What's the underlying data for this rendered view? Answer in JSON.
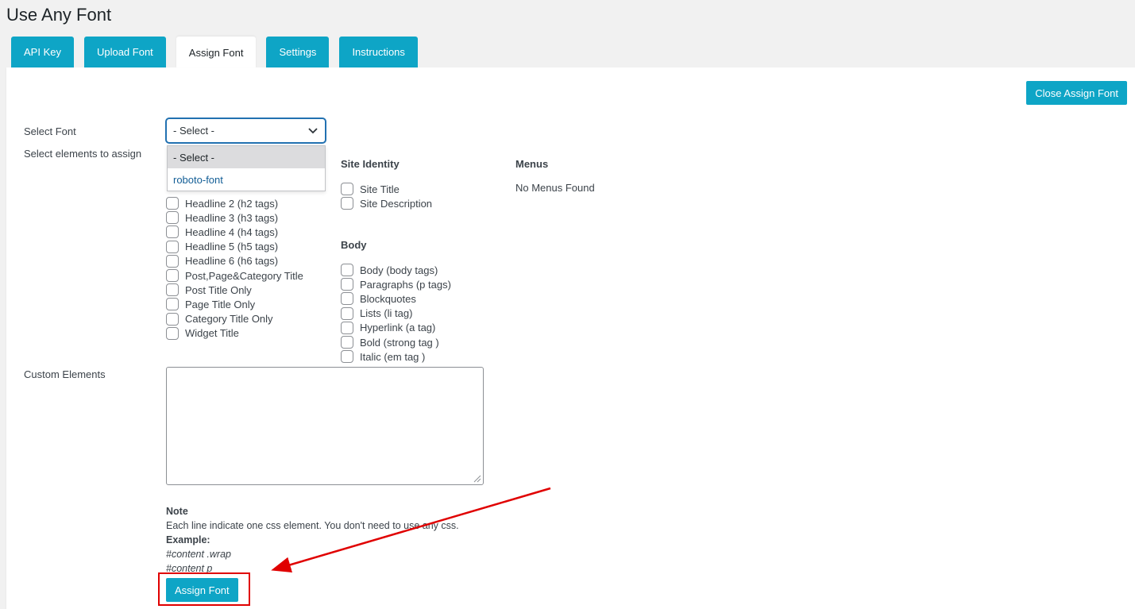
{
  "page": {
    "title": "Use Any Font"
  },
  "tabs": [
    {
      "label": "API Key",
      "active": false
    },
    {
      "label": "Upload Font",
      "active": false
    },
    {
      "label": "Assign Font",
      "active": true
    },
    {
      "label": "Settings",
      "active": false
    },
    {
      "label": "Instructions",
      "active": false
    }
  ],
  "panel": {
    "close_button": "Close Assign Font",
    "select_font_label": "Select Font",
    "select_elements_label": "Select elements to assign",
    "select": {
      "current": "- Select -",
      "options": [
        "- Select -",
        "roboto-font"
      ]
    },
    "headlines": [
      "Headline 2 (h2 tags)",
      "Headline 3 (h3 tags)",
      "Headline 4 (h4 tags)",
      "Headline 5 (h5 tags)",
      "Headline 6 (h6 tags)",
      "Post,Page&Category Title",
      "Post Title Only",
      "Page Title Only",
      "Category Title Only",
      "Widget Title"
    ],
    "site_identity": {
      "heading": "Site Identity",
      "items": [
        "Site Title",
        "Site Description"
      ]
    },
    "body": {
      "heading": "Body",
      "items": [
        "Body (body tags)",
        "Paragraphs (p tags)",
        "Blockquotes",
        "Lists (li tag)",
        "Hyperlink (a tag)",
        "Bold (strong tag )",
        "Italic (em tag )"
      ]
    },
    "menus": {
      "heading": "Menus",
      "empty_text": "No Menus Found"
    },
    "custom_elements_label": "Custom Elements",
    "note": {
      "heading": "Note",
      "text": "Each line indicate one css element. You don't need to use any css.",
      "example_label": "Example:",
      "example_lines": [
        "#content .wrap",
        "#content p"
      ]
    },
    "assign_button": "Assign Font"
  },
  "colors": {
    "accent": "#0ea5c6",
    "annotation": "#e00000"
  }
}
